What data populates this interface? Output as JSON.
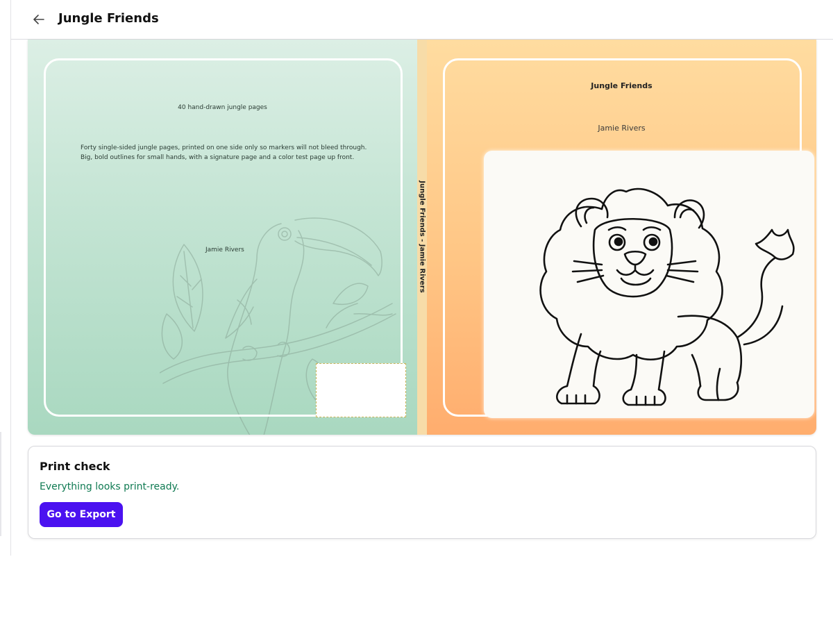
{
  "header": {
    "back_icon": "arrow-left-icon",
    "title": "Jungle Friends"
  },
  "cover": {
    "back": {
      "tagline": "40 hand-drawn jungle pages",
      "blurb": "Forty single-sided jungle pages, printed on one side only so markers will not bleed through. Big, bold outlines for small hands, with a signature page and a color test page up front.",
      "author": "Jamie Rivers",
      "illustration": "toucan-outline-icon",
      "color_top": "#dcefe5",
      "color_bottom": "#a9d8c0"
    },
    "spine": {
      "text": "Jungle Friends - Jamie Rivers",
      "color": "#f7dca8"
    },
    "front": {
      "title": "Jungle Friends",
      "author": "Jamie Rivers",
      "illustration": "lion-line-art-icon",
      "color_top": "#ffdca0",
      "color_bottom": "#ffad6e"
    }
  },
  "print_check": {
    "title": "Print check",
    "status": "Everything looks print-ready.",
    "status_color": "#0f7a52",
    "button_label": "Go to Export",
    "button_color": "#4b12f0"
  }
}
